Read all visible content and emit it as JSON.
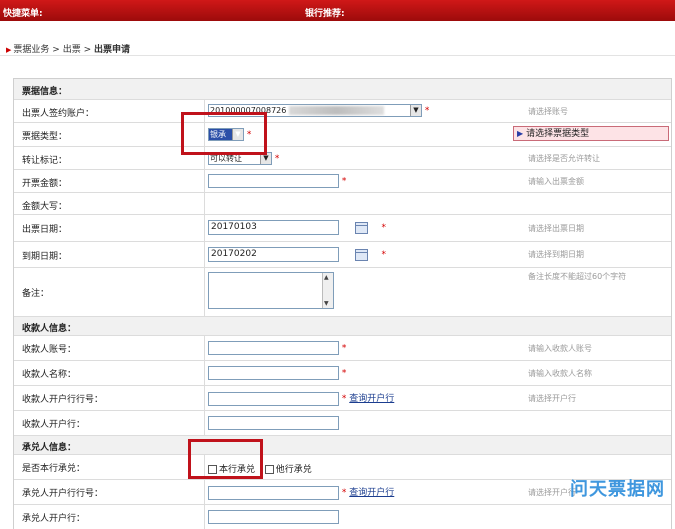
{
  "topbar": {
    "quick_menu": "快捷菜单:",
    "bank_recommend": "银行推荐:"
  },
  "breadcrumb": {
    "part1": "票据业务",
    "part2": "出票",
    "part3": "出票申请",
    "sep": ">"
  },
  "sections": {
    "bill_info": "票据信息：",
    "payee_info": "收款人信息：",
    "acceptor_info": "承兑人信息："
  },
  "fields": {
    "drawer_account": {
      "label": "出票人签约账户：",
      "value": "201000007008726",
      "hint": "请选择账号"
    },
    "bill_type": {
      "label": "票据类型：",
      "value": "银承",
      "hint": "请选择票据类型"
    },
    "transfer_mark": {
      "label": "转让标记：",
      "value": "可以转让",
      "hint": "请选择是否允许转让"
    },
    "amount": {
      "label": "开票金额：",
      "value": "",
      "hint": "请输入出票金额"
    },
    "amount_upper": {
      "label": "金额大写："
    },
    "issue_date": {
      "label": "出票日期：",
      "value": "20170103",
      "hint": "请选择出票日期"
    },
    "due_date": {
      "label": "到期日期：",
      "value": "20170202",
      "hint": "请选择到期日期"
    },
    "remark": {
      "label": "备注：",
      "hint": "备注长度不能超过60个字符"
    },
    "payee_account": {
      "label": "收款人账号：",
      "value": "",
      "hint": "请输入收款人账号"
    },
    "payee_name": {
      "label": "收款人名称：",
      "value": "",
      "hint": "请输入收款人名称"
    },
    "payee_bank_no": {
      "label": "收款人开户行行号：",
      "value": "",
      "link": "查询开户行",
      "hint": "请选择开户行"
    },
    "payee_bank": {
      "label": "收款人开户行：",
      "value": ""
    },
    "self_accept": {
      "label": "是否本行承兑：",
      "opt1": "本行承兑",
      "opt2": "他行承兑"
    },
    "acceptor_bank_no": {
      "label": "承兑人开户行行号：",
      "value": "",
      "link": "查询开户行",
      "hint": "请选择开户行"
    },
    "acceptor_bank": {
      "label": "承兑人开户行：",
      "value": ""
    }
  },
  "star": "*",
  "watermark": "问天票据网"
}
